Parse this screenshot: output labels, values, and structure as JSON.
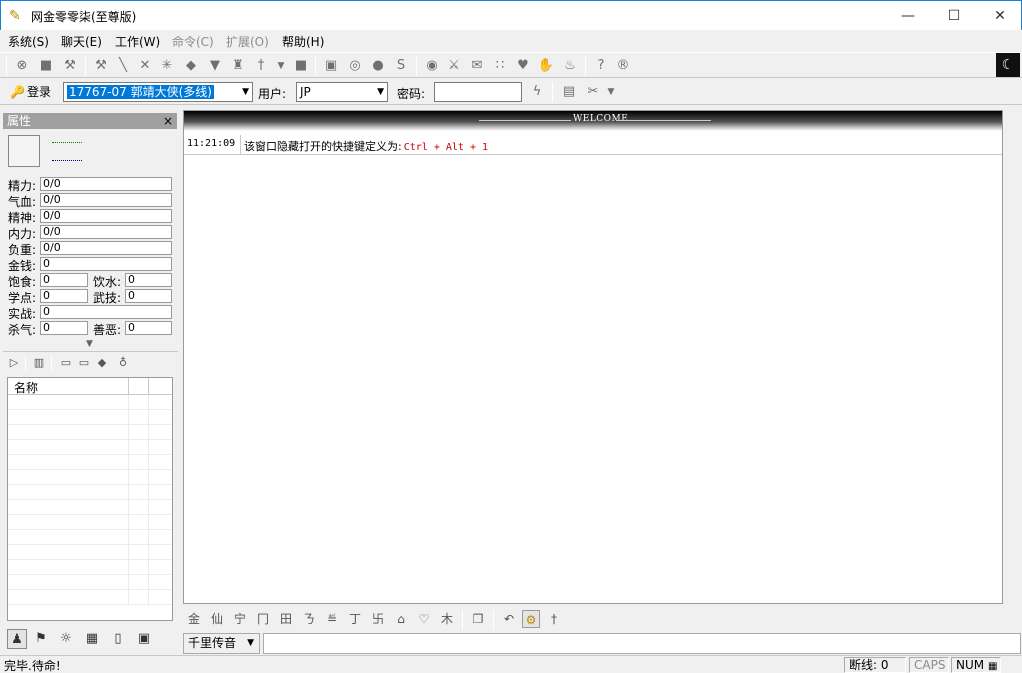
{
  "window": {
    "title": "网金零零柒(至尊版)",
    "min_glyph": "—",
    "max_glyph": "☐",
    "close_glyph": "✕"
  },
  "menu": [
    {
      "label": "系统(S)",
      "enabled": true
    },
    {
      "label": "聊天(E)",
      "enabled": true
    },
    {
      "label": "工作(W)",
      "enabled": true
    },
    {
      "label": "命令(C)",
      "enabled": false
    },
    {
      "label": "扩展(O)",
      "enabled": false
    },
    {
      "label": "帮助(H)",
      "enabled": true
    }
  ],
  "login": {
    "button_label": "登录",
    "account_selected": "17767-07 郭靖大侠(多线)",
    "user_label": "用户:",
    "user_value": "JP",
    "password_label": "密码:",
    "password_value": ""
  },
  "properties": {
    "title": "属性",
    "close_glyph": "×",
    "stats": [
      {
        "label": "精力:",
        "value": "0/0"
      },
      {
        "label": "气血:",
        "value": "0/0"
      },
      {
        "label": "精神:",
        "value": "0/0"
      },
      {
        "label": "内力:",
        "value": "0/0"
      },
      {
        "label": "负重:",
        "value": "0/0"
      },
      {
        "label": "金钱:",
        "value": "0"
      },
      {
        "label": "饱食:",
        "value": "0"
      },
      {
        "label": "饮水:",
        "value": "0"
      },
      {
        "label": "学点:",
        "value": "0"
      },
      {
        "label": "武技:",
        "value": "0"
      },
      {
        "label": "实战:",
        "value": "0"
      },
      {
        "label": "杀气:",
        "value": "0"
      },
      {
        "label": "善恶:",
        "value": "0"
      }
    ]
  },
  "name_list": {
    "column_header": "名称"
  },
  "welcome": {
    "banner": "WELCOME"
  },
  "messages": [
    {
      "time": "11:21:09",
      "text": "该窗口隐藏打开的快捷键定义为:",
      "shortcut": "Ctrl + Alt + 1"
    }
  ],
  "chat": {
    "channel": "千里传音"
  },
  "status": {
    "text": "完毕.待命!",
    "disconnect_label": "断线: 0",
    "caps": "CAPS",
    "num": "NUM"
  },
  "colors": {
    "accent": "#0078d7",
    "shortcut_red": "#d00000"
  }
}
